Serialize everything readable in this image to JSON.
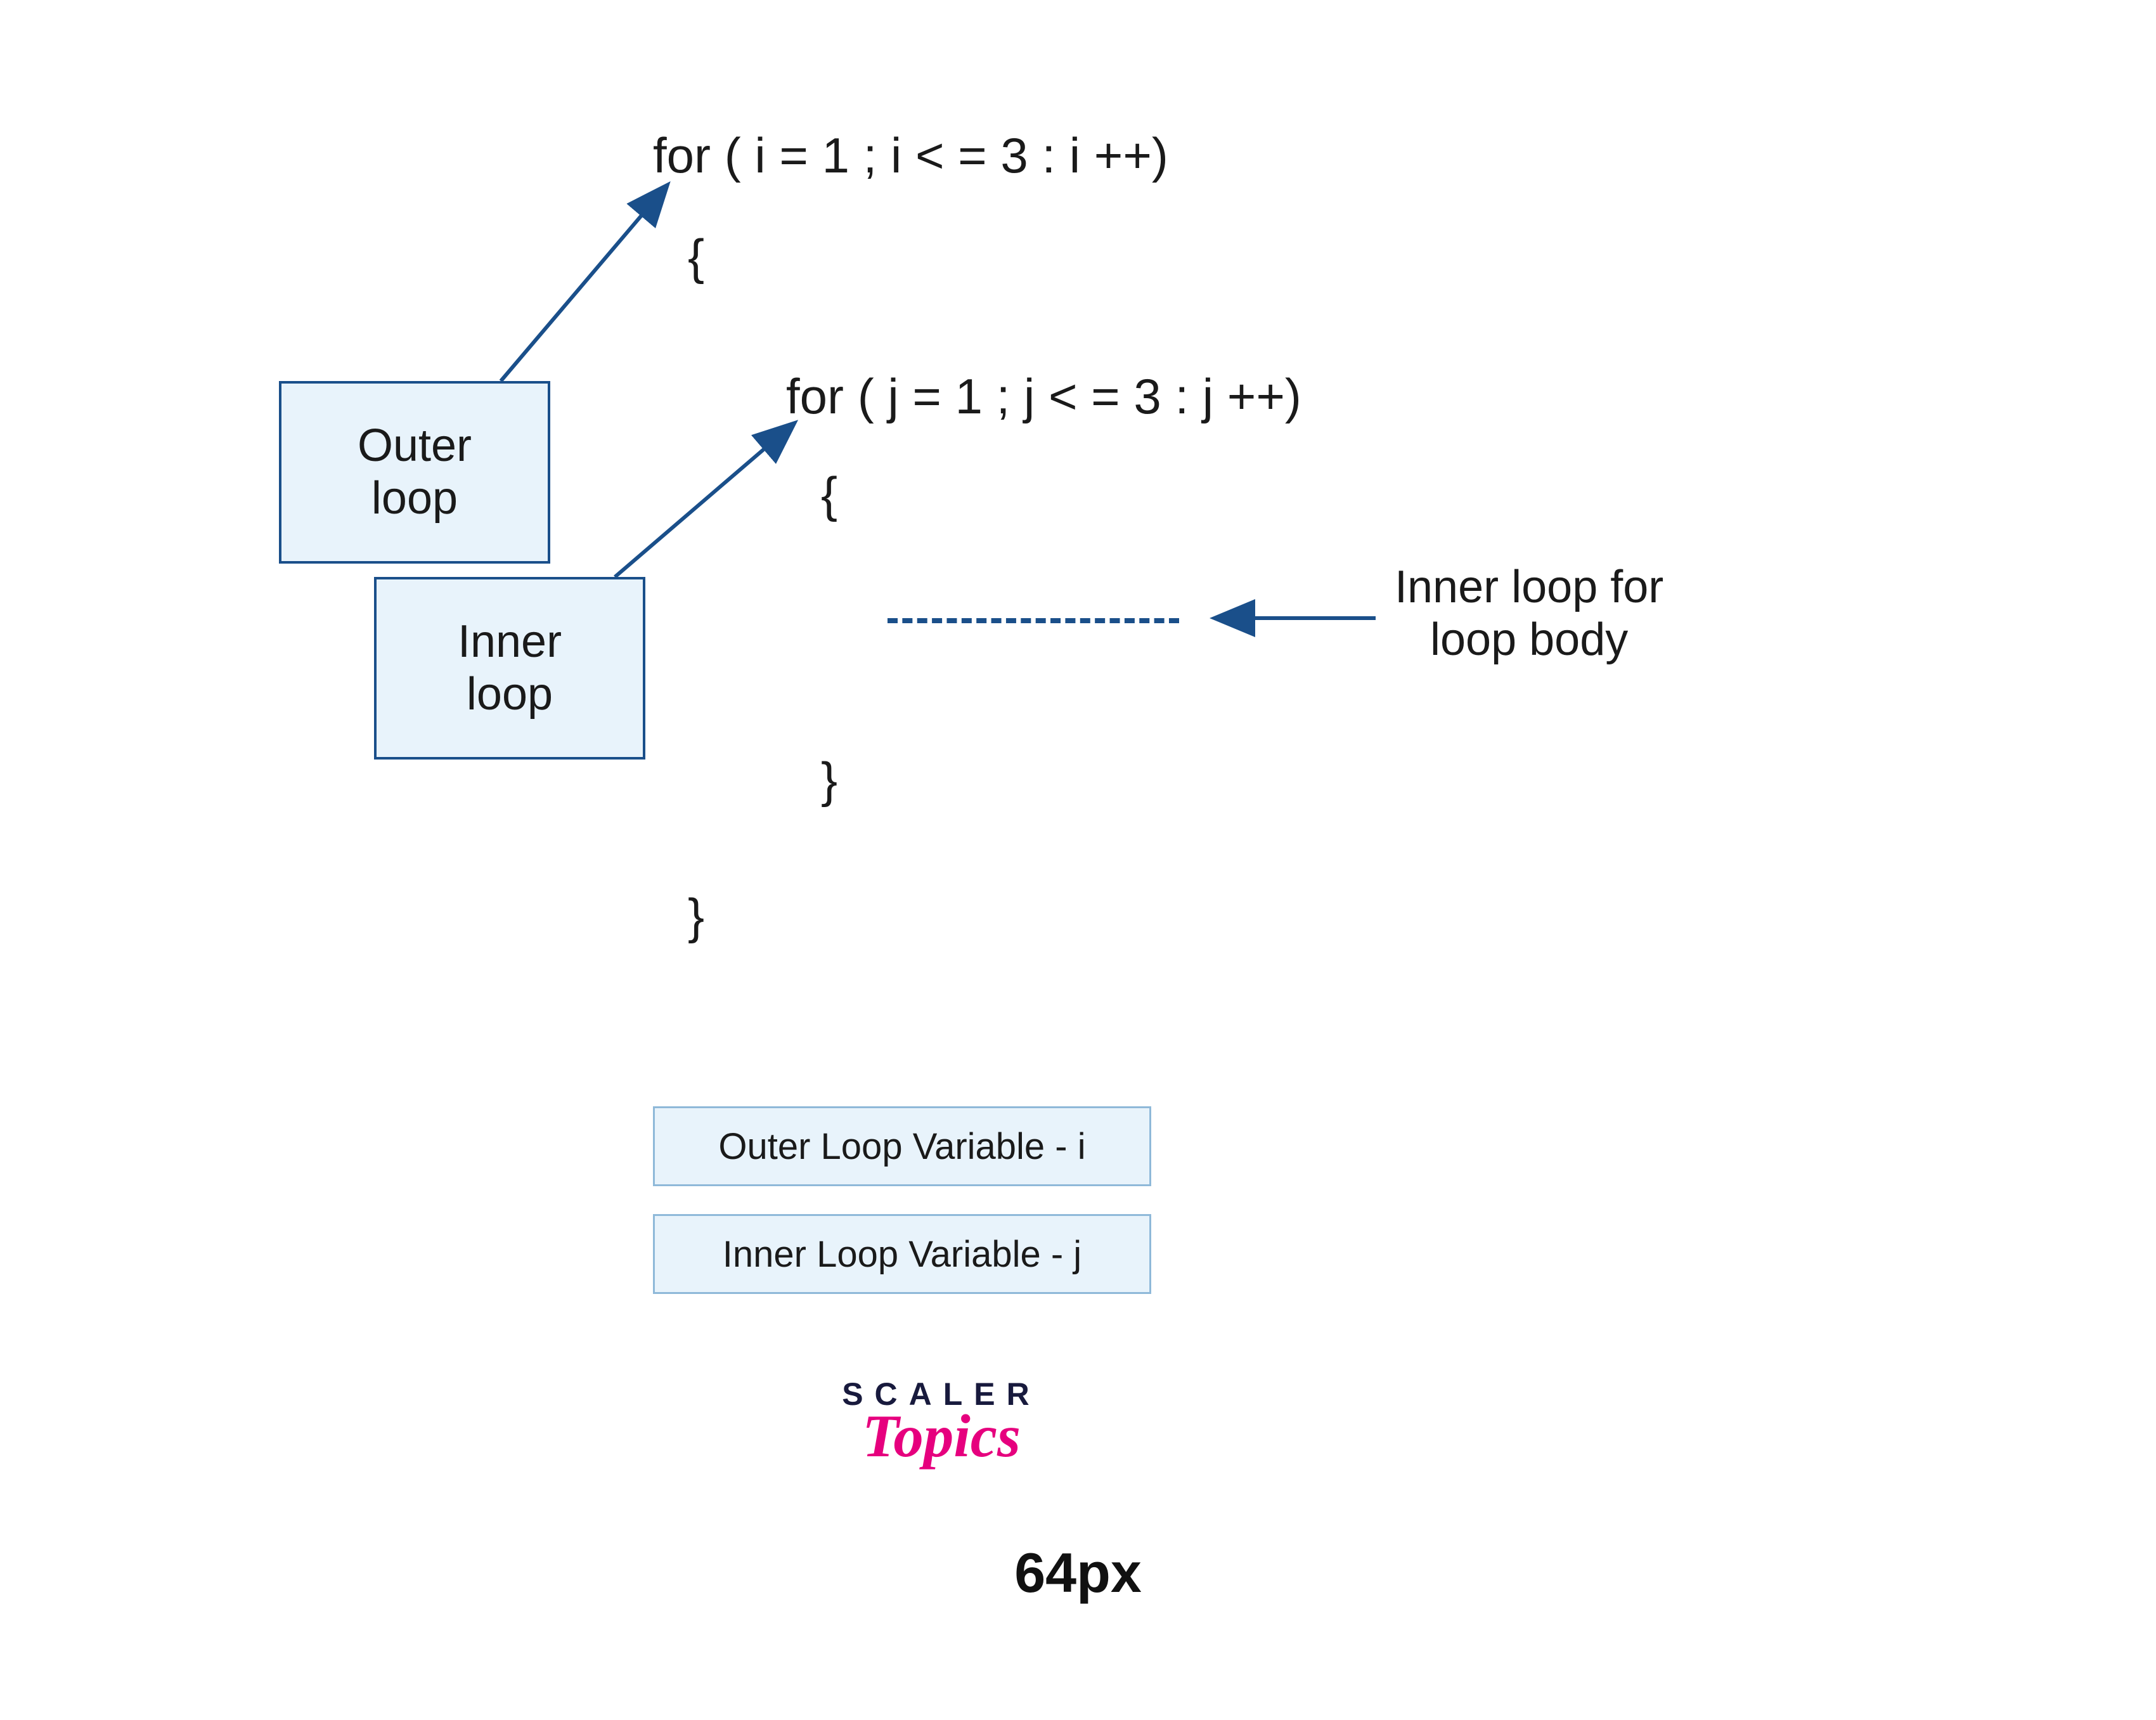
{
  "code": {
    "outer_for": "for ( i = 1 ; i < = 3 : i ++)",
    "outer_open_brace": "{",
    "inner_for": "for ( j = 1 ; j < = 3 : j ++)",
    "inner_open_brace": "{",
    "inner_close_brace": "}",
    "outer_close_brace": "}"
  },
  "labels": {
    "outer_loop": "Outer\nloop",
    "inner_loop": "Inner\nloop",
    "inner_body_annotation": "Inner loop for\nloop body"
  },
  "legend": {
    "outer_var": "Outer Loop Variable - i",
    "inner_var": "Inner Loop Variable - j"
  },
  "logo": {
    "scaler": "SCALER",
    "topics": "Topics"
  },
  "footer": {
    "size_label": "64px"
  },
  "colors": {
    "arrow": "#1a4f8a",
    "box_fill": "#e8f3fb",
    "box_border": "#1a4f8a",
    "legend_border": "#8fb9d9",
    "logo_pink": "#e6007e",
    "logo_dark": "#181a3d"
  }
}
